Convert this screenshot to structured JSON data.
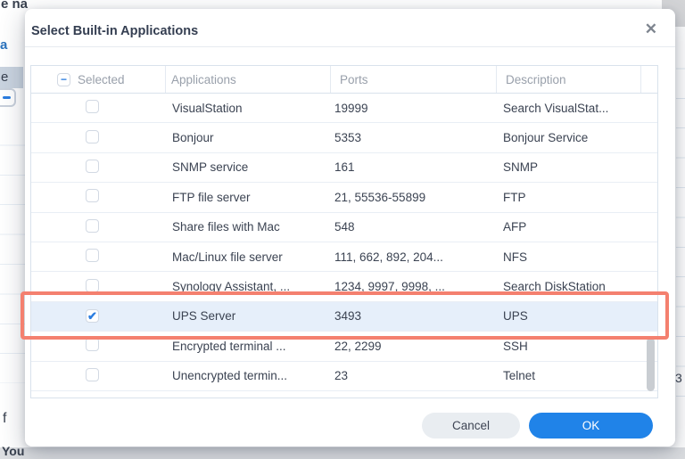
{
  "icons": {
    "close": "✕",
    "check": "✔",
    "indeterminate": "−"
  },
  "dialog": {
    "title": "Select Built-in Applications"
  },
  "table": {
    "columns": {
      "selected": "Selected",
      "applications": "Applications",
      "ports": "Ports",
      "description": "Description"
    },
    "rows": [
      {
        "app": "VisualStation",
        "ports": "19999",
        "desc": "Search VisualStat...",
        "checked": false,
        "highlighted": false
      },
      {
        "app": "Bonjour",
        "ports": "5353",
        "desc": "Bonjour Service",
        "checked": false,
        "highlighted": false
      },
      {
        "app": "SNMP service",
        "ports": "161",
        "desc": "SNMP",
        "checked": false,
        "highlighted": false
      },
      {
        "app": "FTP file server",
        "ports": "21, 55536-55899",
        "desc": "FTP",
        "checked": false,
        "highlighted": false
      },
      {
        "app": "Share files with Mac",
        "ports": "548",
        "desc": "AFP",
        "checked": false,
        "highlighted": false
      },
      {
        "app": "Mac/Linux file server",
        "ports": "111, 662, 892, 204...",
        "desc": "NFS",
        "checked": false,
        "highlighted": false
      },
      {
        "app": "Synology Assistant, ...",
        "ports": "1234, 9997, 9998, ...",
        "desc": "Search DiskStation",
        "checked": false,
        "highlighted": false
      },
      {
        "app": "UPS Server",
        "ports": "3493",
        "desc": "UPS",
        "checked": true,
        "highlighted": true
      },
      {
        "app": "Encrypted terminal ...",
        "ports": "22, 2299",
        "desc": "SSH",
        "checked": false,
        "highlighted": false
      },
      {
        "app": "Unencrypted termin...",
        "ports": "23",
        "desc": "Telnet",
        "checked": false,
        "highlighted": false
      }
    ]
  },
  "footer": {
    "cancel": "Cancel",
    "ok": "OK"
  },
  "colors": {
    "accent_blue": "#2083e8",
    "row_highlight": "#e6effa",
    "annotation_red": "#f4806f"
  },
  "background": {
    "top_left_text": "e na",
    "link_char": "a",
    "selected_char": "e",
    "char_f": "f",
    "bottom_text": "You",
    "right_digit": "3"
  }
}
